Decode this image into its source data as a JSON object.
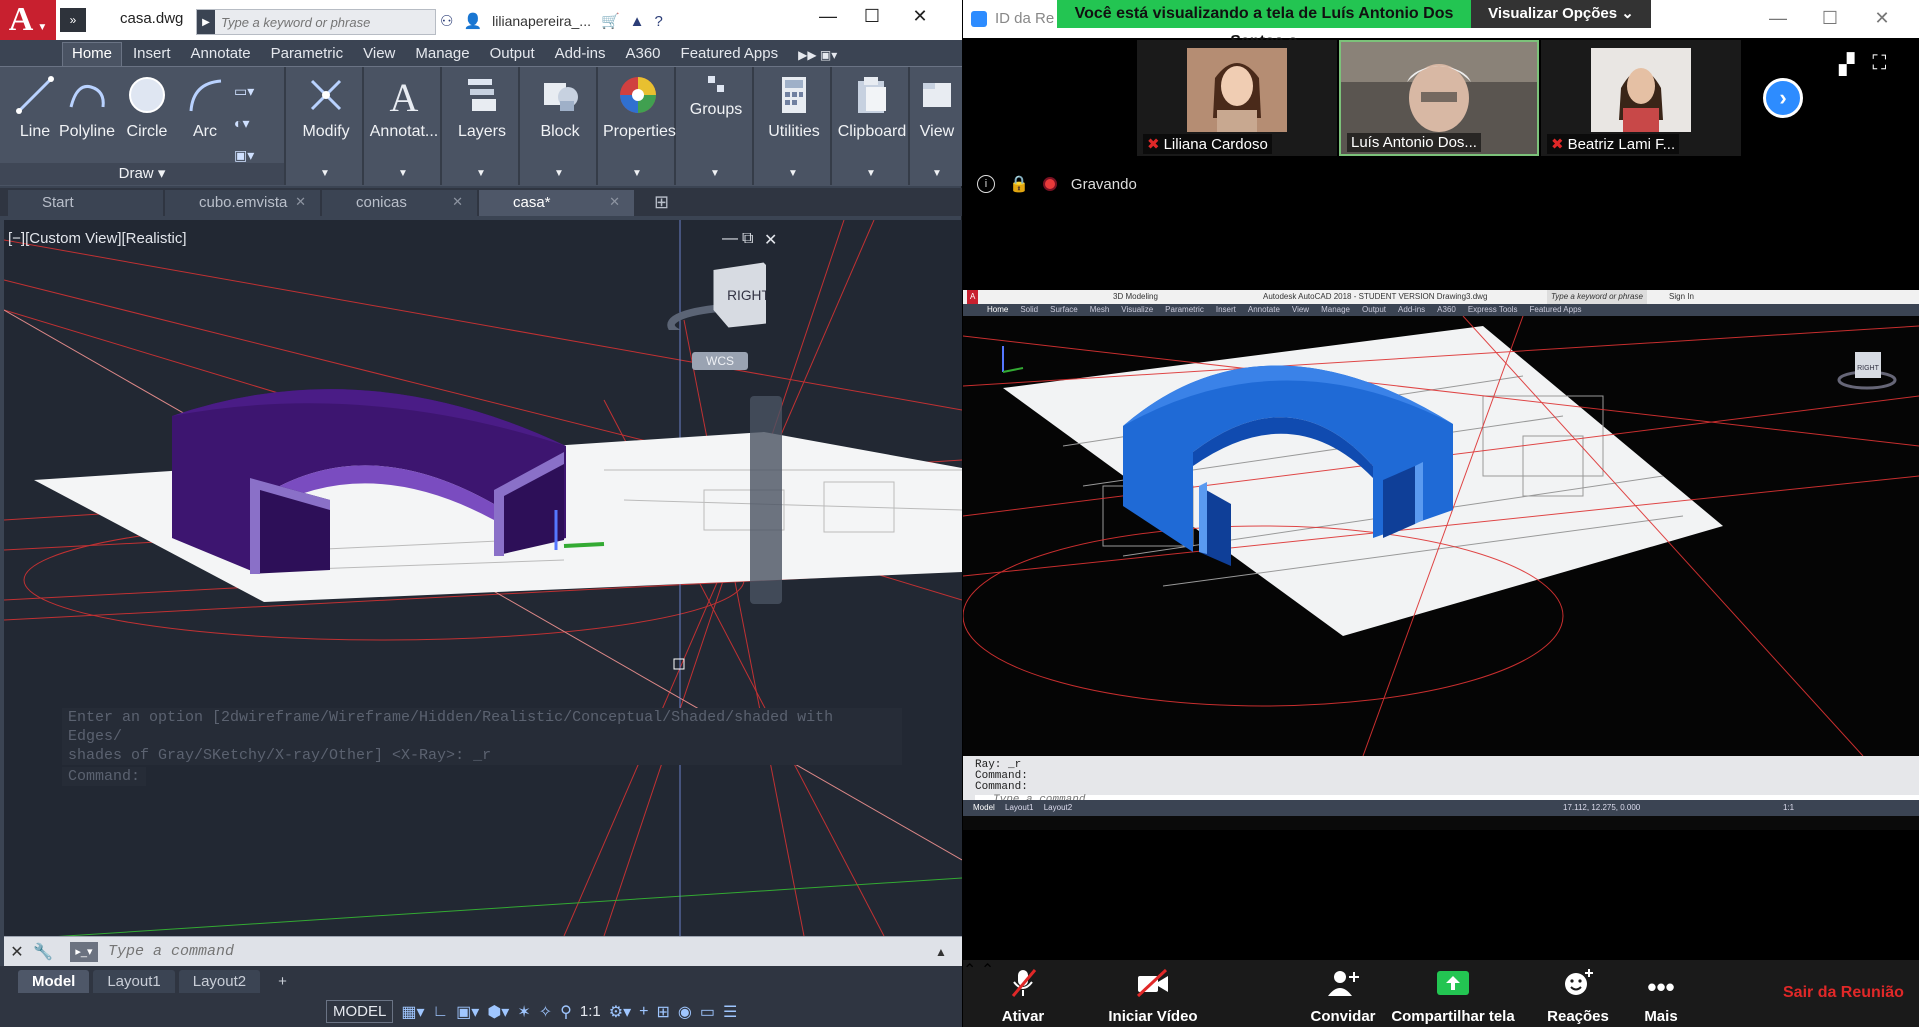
{
  "acad": {
    "file_name": "casa.dwg",
    "search_placeholder": "Type a keyword or phrase",
    "user": "lilianapereira_...",
    "ribbon_tabs": [
      "Home",
      "Insert",
      "Annotate",
      "Parametric",
      "View",
      "Manage",
      "Output",
      "Add-ins",
      "A360",
      "Featured Apps"
    ],
    "draw_tools": [
      "Line",
      "Polyline",
      "Circle",
      "Arc"
    ],
    "draw_panel_label": "Draw",
    "panels": [
      "Modify",
      "Annotat...",
      "Layers",
      "Block",
      "Properties",
      "Groups",
      "Utilities",
      "Clipboard",
      "View"
    ],
    "doc_tabs": [
      "Start",
      "cubo.emvista",
      "conicas",
      "casa*"
    ],
    "viewport_label": "[−][Custom View][Realistic]",
    "cube_face": "RIGHT",
    "wcs": "WCS",
    "cmd_history": [
      "Enter an option [2dwireframe/Wireframe/Hidden/Realistic/Conceptual/Shaded/shaded with Edges/",
      "shades of Gray/SKetchy/X-ray/Other] <X-Ray>: _r",
      "Command:"
    ],
    "cmd_placeholder": "Type a command",
    "layout_tabs": [
      "Model",
      "Layout1",
      "Layout2"
    ],
    "status_model": "MODEL",
    "status_scale": "1:1"
  },
  "zoom": {
    "window_title": "ID da Re",
    "banner": "Você está visualizando a tela de Luís Antonio Dos Santos o",
    "view_options": "Visualizar Opções",
    "participants": [
      {
        "name": "Liliana Cardoso",
        "muted": true
      },
      {
        "name": "Luís Antonio Dos...",
        "muted": false
      },
      {
        "name": "Beatriz Lami F...",
        "muted": true
      }
    ],
    "recording": "Gravando",
    "shared": {
      "title": "Autodesk AutoCAD 2018 - STUDENT VERSION   Drawing3.dwg",
      "workspace": "3D Modeling",
      "search": "Type a keyword or phrase",
      "signin": "Sign In",
      "tabs": [
        "Home",
        "Solid",
        "Surface",
        "Mesh",
        "Visualize",
        "Parametric",
        "Insert",
        "Annotate",
        "View",
        "Manage",
        "Output",
        "Add-ins",
        "A360",
        "Express Tools",
        "Featured Apps"
      ],
      "cube_face": "RIGHT",
      "cmd_history": [
        "Ray: _r",
        "Command:",
        "Command:"
      ],
      "cmd_placeholder": "Type a command",
      "layout_tabs": [
        "Model",
        "Layout1",
        "Layout2"
      ],
      "coords": "17.112, 12.275, 0.000",
      "scale": "1:1"
    },
    "toolbar": {
      "mute": "Ativar",
      "video": "Iniciar Vídeo",
      "invite": "Convidar",
      "share": "Compartilhar tela",
      "reactions": "Reações",
      "more": "Mais",
      "leave": "Sair da Reunião"
    }
  },
  "colors": {
    "autocad_red": "#c8202f",
    "zoom_green": "#23c552",
    "zoom_blue": "#2d8cff",
    "leave_red": "#e02828",
    "solid_purple": "#3d1570",
    "solid_blue": "#1f6ad6"
  }
}
